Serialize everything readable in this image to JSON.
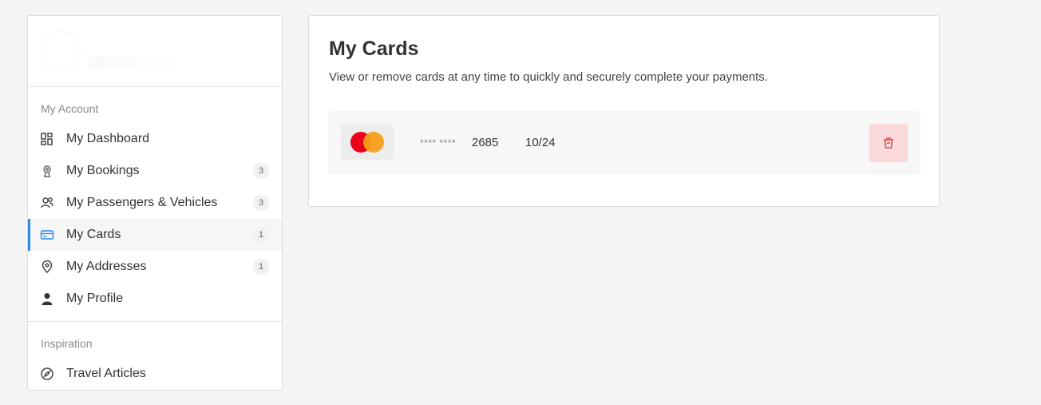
{
  "sidebar": {
    "sections": {
      "account_label": "My Account",
      "inspiration_label": "Inspiration"
    },
    "items": [
      {
        "label": "My Dashboard",
        "icon": "dashboard-icon",
        "badge": null
      },
      {
        "label": "My Bookings",
        "icon": "bookings-icon",
        "badge": "3"
      },
      {
        "label": "My Passengers & Vehicles",
        "icon": "passengers-icon",
        "badge": "3"
      },
      {
        "label": "My Cards",
        "icon": "card-icon",
        "badge": "1",
        "active": true
      },
      {
        "label": "My Addresses",
        "icon": "location-pin-icon",
        "badge": "1"
      },
      {
        "label": "My Profile",
        "icon": "user-icon",
        "badge": null
      }
    ],
    "inspiration_items": [
      {
        "label": "Travel Articles",
        "icon": "compass-icon"
      }
    ]
  },
  "main": {
    "title": "My Cards",
    "subtitle": "View or remove cards at any time to quickly and securely complete your payments.",
    "cards": [
      {
        "brand": "mastercard",
        "mask": "**** ****",
        "last4": "2685",
        "expiry": "10/24"
      }
    ]
  },
  "colors": {
    "accent": "#2e8ae6",
    "delete_bg": "#f9d9d9",
    "delete_icon": "#d9534f",
    "mc_red": "#eb001b",
    "mc_yellow": "#f79e1b"
  }
}
